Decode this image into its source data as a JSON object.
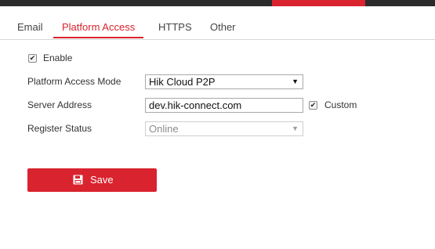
{
  "tabs": [
    {
      "label": "Email",
      "active": false
    },
    {
      "label": "Platform Access",
      "active": true
    },
    {
      "label": "HTTPS",
      "active": false
    },
    {
      "label": "Other",
      "active": false
    }
  ],
  "form": {
    "enable": {
      "label": "Enable",
      "checked": true,
      "check_glyph": "✔"
    },
    "platform_mode": {
      "label": "Platform Access Mode",
      "value": "Hik Cloud P2P",
      "arrow": "▼"
    },
    "server_address": {
      "label": "Server Address",
      "value": "dev.hik-connect.com"
    },
    "custom": {
      "label": "Custom",
      "checked": true,
      "check_glyph": "✔"
    },
    "register_status": {
      "label": "Register Status",
      "value": "Online",
      "arrow": "▼"
    }
  },
  "save_button": {
    "label": "Save",
    "icon": "floppy-disk-icon"
  },
  "colors": {
    "accent": "#d9232e",
    "topbar": "#2b2b2b"
  }
}
